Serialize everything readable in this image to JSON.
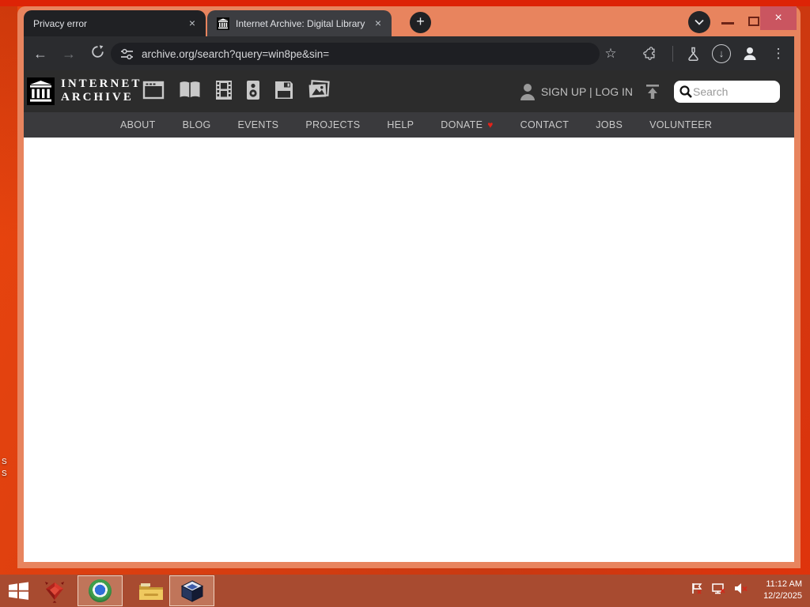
{
  "browser": {
    "tabs": [
      {
        "title": "Privacy error"
      },
      {
        "title": "Internet Archive: Digital Library"
      }
    ],
    "url": "archive.org/search?query=win8pe&sin=",
    "colors": {
      "frame": "#e8845e",
      "toolbar": "#2b2c2f",
      "urlbar": "#1e1f23",
      "tab_inactive": "#202124",
      "tab_active": "#3c3d41",
      "close_button": "#ca5560"
    }
  },
  "glyphs": {
    "close": "×",
    "plus": "+",
    "back": "←",
    "forward": "→",
    "star": "☆",
    "dots": "⋮",
    "down_arrow": "↓",
    "heart": "♥"
  },
  "page": {
    "header": {
      "logo_line1": "INTERNET",
      "logo_line2": "ARCHIVE",
      "signup_login": "SIGN UP | LOG IN",
      "search_placeholder": "Search"
    },
    "nav": {
      "items": [
        "ABOUT",
        "BLOG",
        "EVENTS",
        "PROJECTS",
        "HELP",
        "DONATE",
        "CONTACT",
        "JOBS",
        "VOLUNTEER"
      ]
    },
    "colors": {
      "header_bg": "#2c2c2c",
      "nav_bg": "#3a3a3d",
      "heart": "#e3231a"
    }
  },
  "desktop": {
    "fragments": [
      "S",
      "S"
    ],
    "colors": {
      "base": "#d93e10",
      "stripe": "#dd2306"
    }
  },
  "taskbar": {
    "clock_time": "11:12 AM",
    "clock_date": "12/2/2025",
    "colors": {
      "bg": "#a84b30"
    }
  }
}
